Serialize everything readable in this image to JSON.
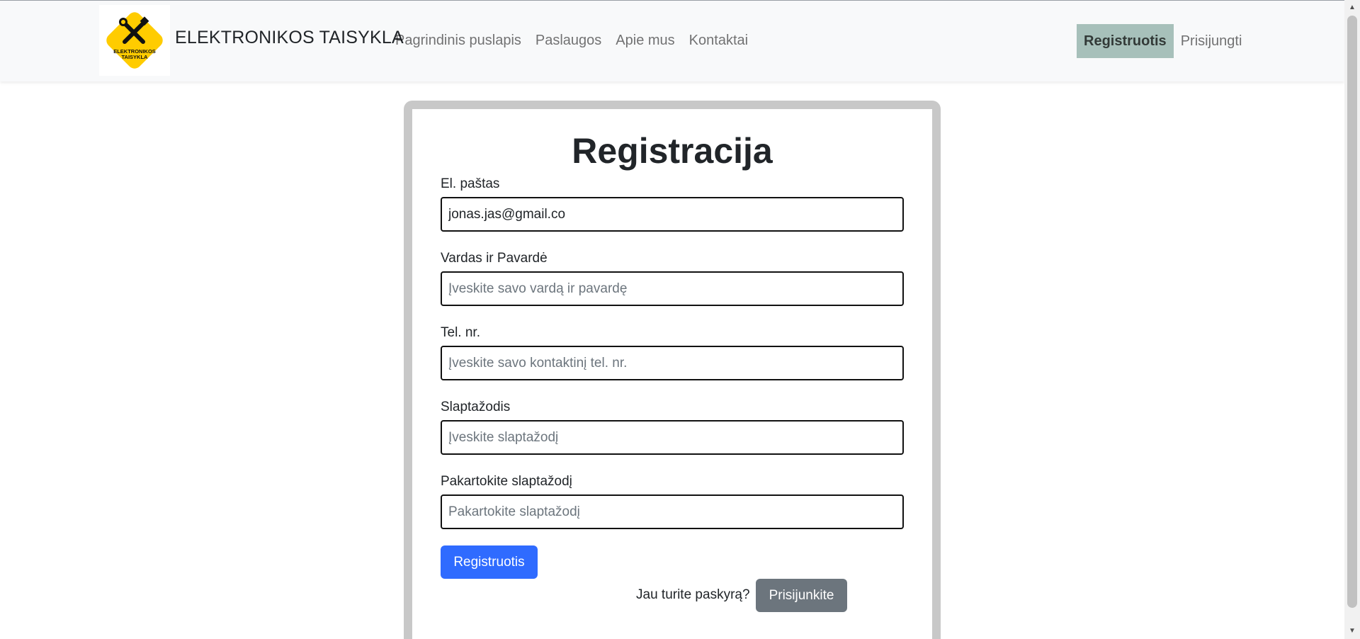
{
  "navbar": {
    "brand": "ELEKTRONIKOS TAISYKLA",
    "logo_text": "ELEKTRONIKOS TAISYKLA",
    "links": [
      {
        "label": "Pagrindinis puslapis"
      },
      {
        "label": "Paslaugos"
      },
      {
        "label": "Apie mus"
      },
      {
        "label": "Kontaktai"
      }
    ],
    "register_label": "Registruotis",
    "login_label": "Prisijungti"
  },
  "form": {
    "title": "Registracija",
    "fields": [
      {
        "label": "El. paštas",
        "value": "jonas.jas@gmail.co",
        "placeholder": ""
      },
      {
        "label": "Vardas ir Pavardė",
        "value": "",
        "placeholder": "Įveskite savo vardą ir pavardę"
      },
      {
        "label": "Tel. nr.",
        "value": "",
        "placeholder": "Įveskite savo kontaktinį tel. nr."
      },
      {
        "label": "Slaptažodis",
        "value": "",
        "placeholder": "Įveskite slaptažodį"
      },
      {
        "label": "Pakartokite slaptažodį",
        "value": "",
        "placeholder": "Pakartokite slaptažodį"
      }
    ],
    "submit_label": "Registruotis",
    "have_account_text": "Jau turite paskyrą?",
    "login_button_label": "Prisijunkite"
  },
  "colors": {
    "navbar_bg": "#f8f9fa",
    "active_nav_bg": "#a7c0ba",
    "primary_button": "#2f6bff",
    "secondary_button": "#6c757d",
    "logo_yellow": "#ffcc00"
  },
  "icons": {
    "logo": "tools-crossed-icon",
    "scroll_up": "triangle-up-icon",
    "scroll_down": "triangle-down-icon"
  }
}
